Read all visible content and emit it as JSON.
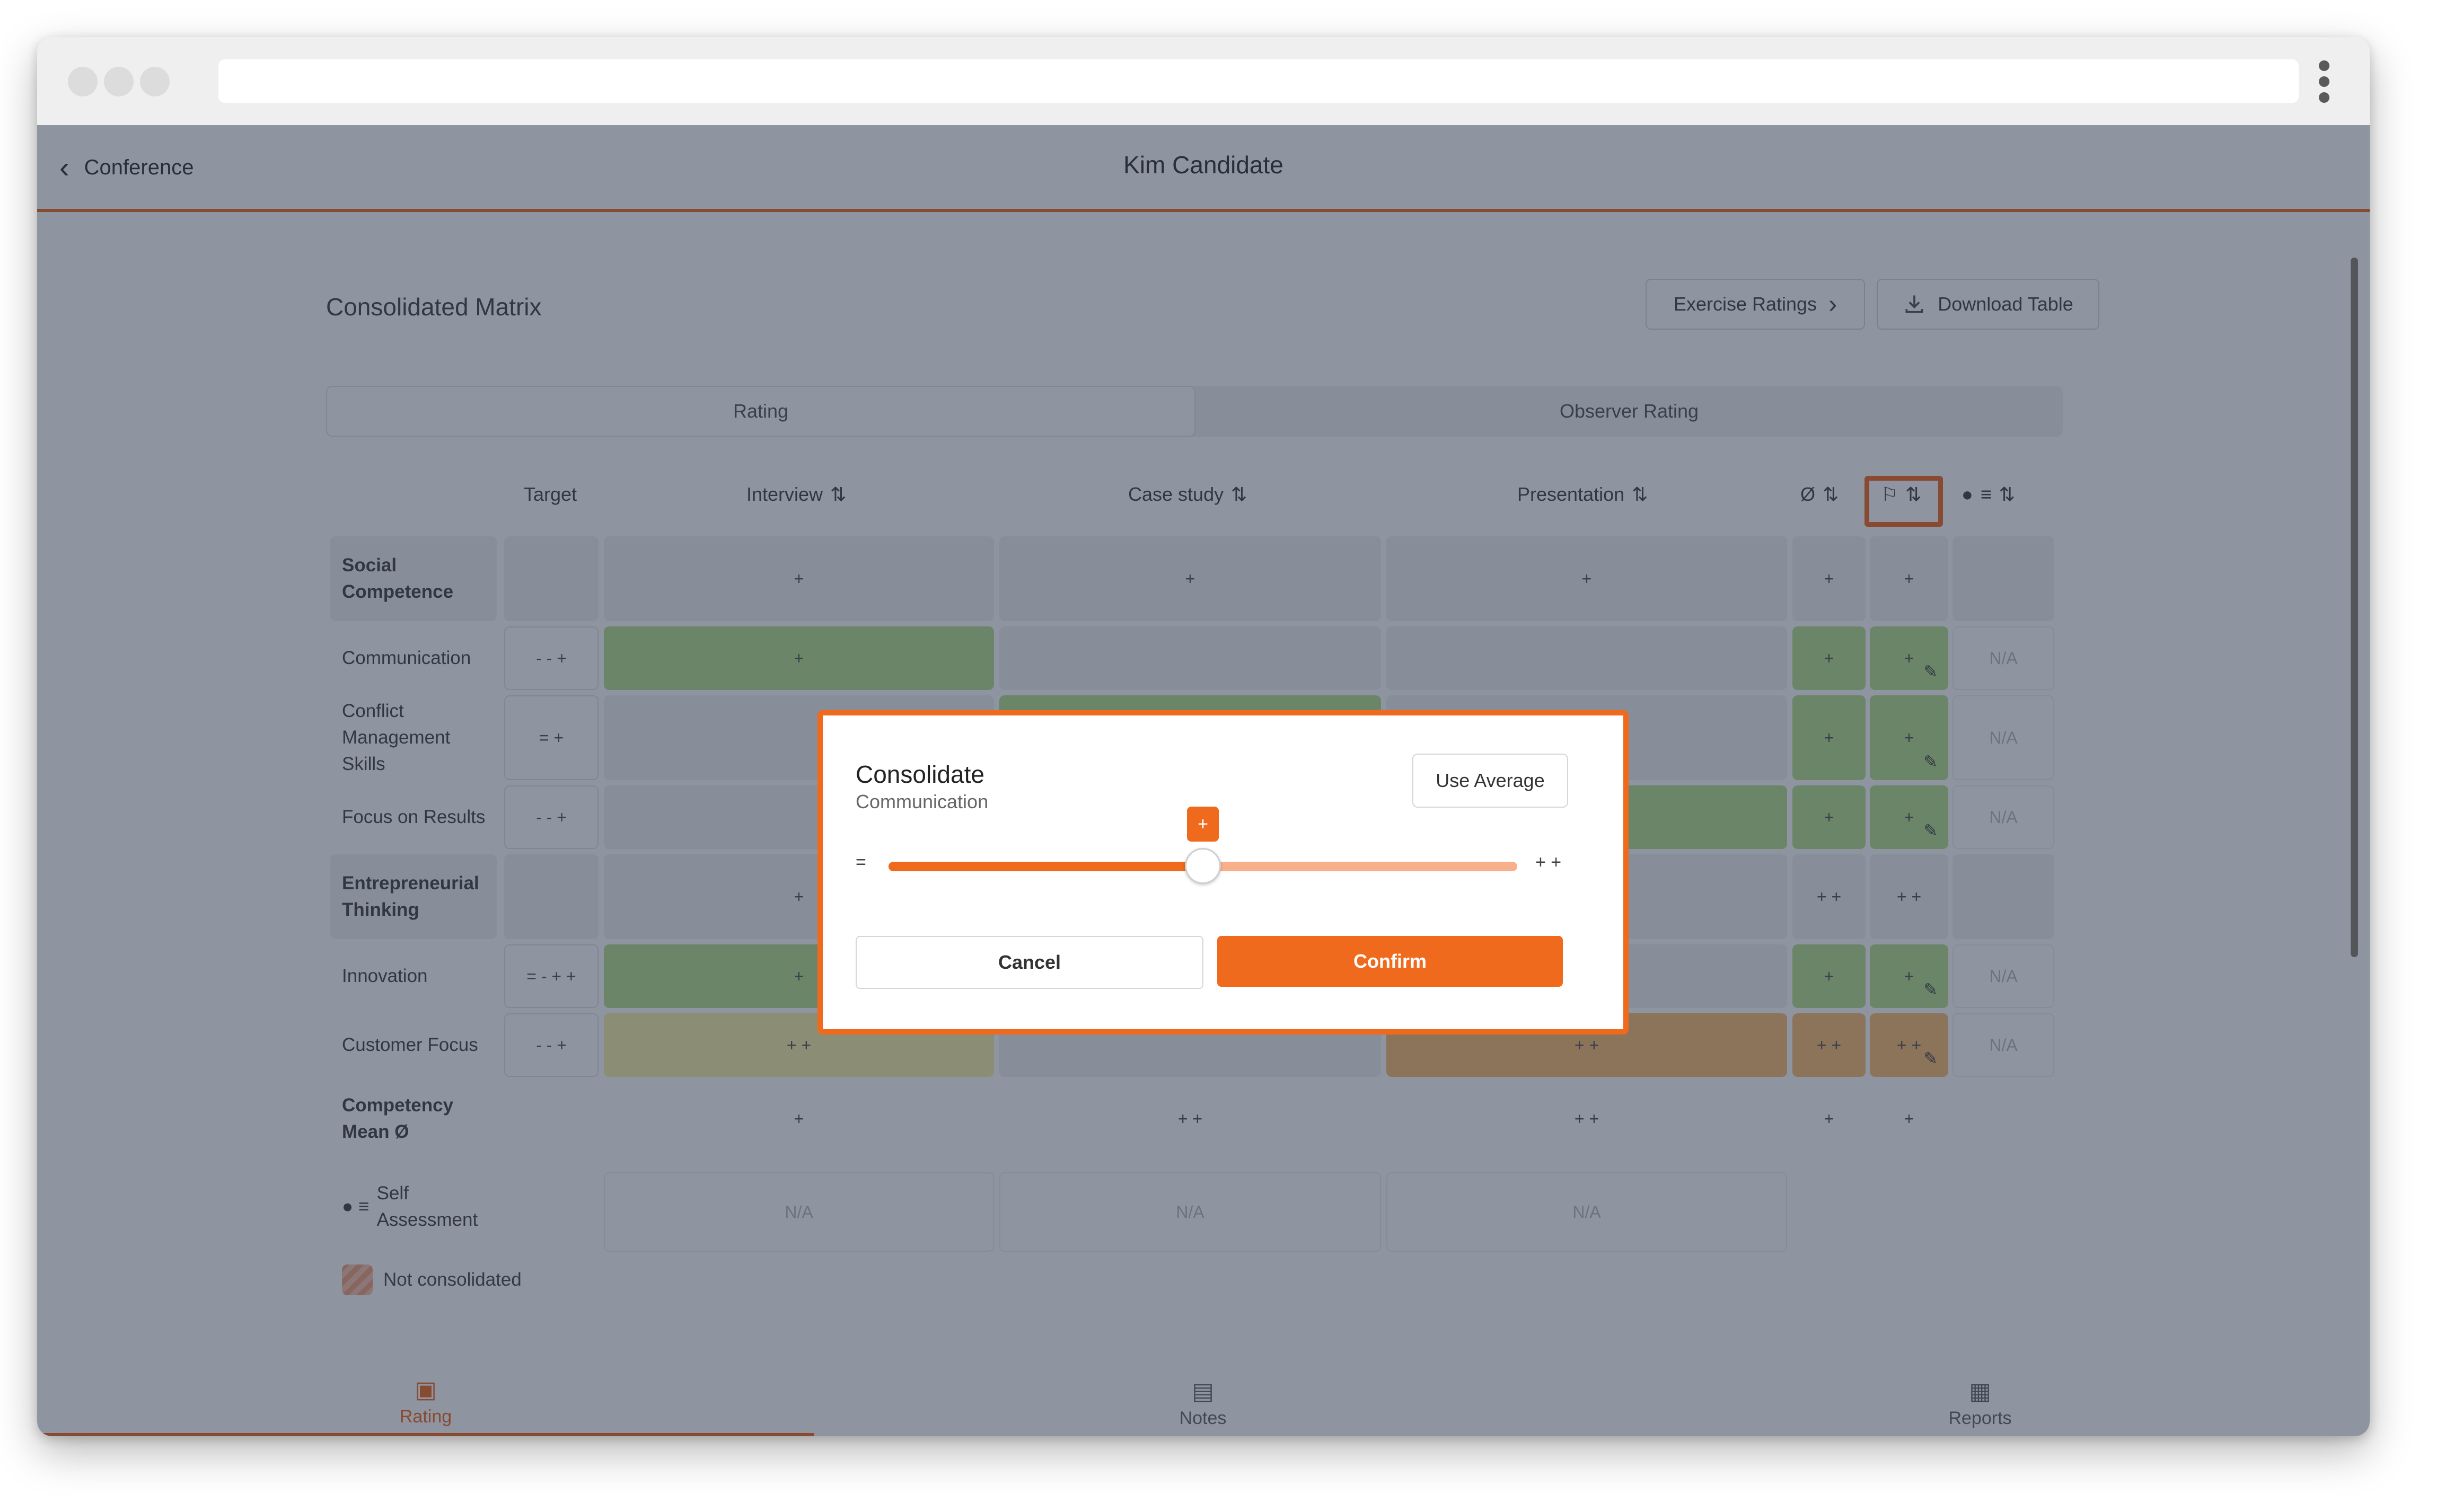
{
  "app": {
    "back_label": "Conference",
    "title": "Kim Candidate"
  },
  "page": {
    "title": "Consolidated Matrix",
    "exercise_ratings_label": "Exercise Ratings",
    "download_label": "Download Table"
  },
  "tabs": [
    {
      "label": "Rating",
      "active": true
    },
    {
      "label": "Observer Rating",
      "active": false
    }
  ],
  "columns": {
    "target": "Target",
    "interview": "Interview",
    "case_study": "Case study",
    "presentation": "Presentation",
    "average": "Ø"
  },
  "rows": [
    {
      "label": "Social Competence",
      "group": true,
      "target": "",
      "interview": "+",
      "case_study": "+",
      "presentation": "+",
      "avg": "+",
      "consolidated": "+",
      "self": ""
    },
    {
      "label": "Communication",
      "group": false,
      "target": "- - +",
      "interview": "+",
      "case_study": "",
      "presentation": "",
      "avg": "+",
      "consolidated": "+",
      "self": "N/A"
    },
    {
      "label": "Conflict Management Skills",
      "group": false,
      "target": "= +",
      "interview": "",
      "case_study": "",
      "presentation": "",
      "avg": "+",
      "consolidated": "+",
      "self": "N/A"
    },
    {
      "label": "Focus on Results",
      "group": false,
      "target": "- - +",
      "interview": "",
      "case_study": "",
      "presentation": "",
      "avg": "+",
      "consolidated": "+",
      "self": "N/A"
    },
    {
      "label": "Entrepreneurial Thinking",
      "group": true,
      "target": "",
      "interview": "+",
      "case_study": "",
      "presentation": "",
      "avg": "+ +",
      "consolidated": "+ +",
      "self": ""
    },
    {
      "label": "Innovation",
      "group": false,
      "target": "= - + +",
      "interview": "+",
      "case_study": "",
      "presentation": "",
      "avg": "+",
      "consolidated": "+",
      "self": "N/A"
    },
    {
      "label": "Customer Focus",
      "group": false,
      "target": "- - +",
      "interview": "+ +",
      "case_study": "",
      "presentation": "+ +",
      "avg": "+ +",
      "consolidated": "+ +",
      "self": "N/A"
    }
  ],
  "mean_row": {
    "label": "Competency Mean Ø",
    "interview": "+",
    "case_study": "+ +",
    "presentation": "+ +",
    "avg": "+",
    "consolidated": "+"
  },
  "self_assessment": {
    "label": "Self Assessment",
    "interview": "N/A",
    "case_study": "N/A",
    "presentation": "N/A"
  },
  "legend": {
    "not_consolidated": "Not consolidated"
  },
  "nav": [
    {
      "label": "Rating",
      "active": true
    },
    {
      "label": "Notes",
      "active": false
    },
    {
      "label": "Reports",
      "active": false
    }
  ],
  "modal": {
    "title": "Consolidate",
    "subtitle": "Communication",
    "use_average": "Use Average",
    "slider_min": "=",
    "slider_max": "+ +",
    "slider_value": "+",
    "slider_fraction": 0.5,
    "cancel": "Cancel",
    "confirm": "Confirm"
  },
  "colors": {
    "accent": "#f06a1e",
    "green": "#b5e08a",
    "yellow": "#f6f2a6",
    "orange": "#f7be71"
  }
}
